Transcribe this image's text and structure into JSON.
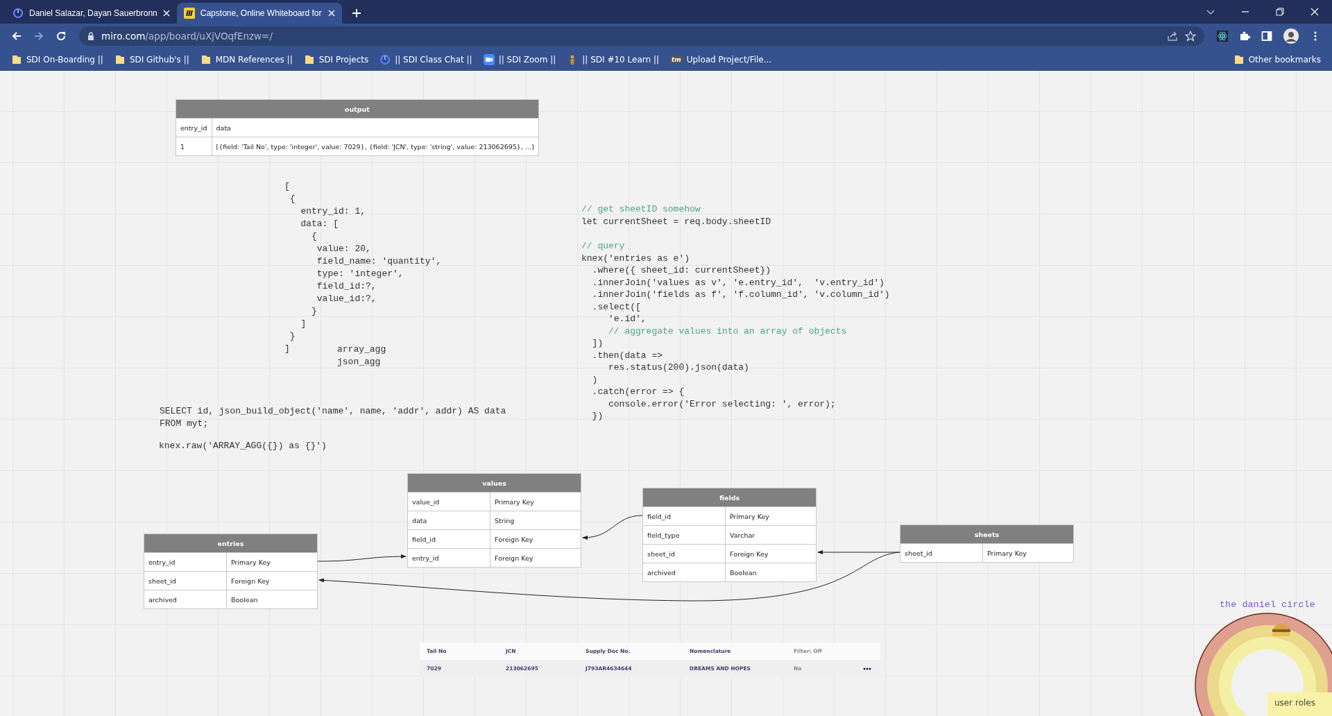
{
  "browser": {
    "tabs": [
      {
        "title": "Daniel Salazar, Dayan Sauerbronn",
        "kind": "ring",
        "selected": false
      },
      {
        "title": "Capstone, Online Whiteboard for",
        "kind": "miro",
        "selected": true
      }
    ],
    "url_host": "miro.com",
    "url_path": "/app/board/uXjVOqfEnzw=/",
    "bookmarks": [
      {
        "label": "SDI On-Boarding ||",
        "kind": "folder"
      },
      {
        "label": "SDI Github's ||",
        "kind": "folder"
      },
      {
        "label": "MDN References ||",
        "kind": "folder"
      },
      {
        "label": "SDI Projects",
        "kind": "folder"
      },
      {
        "label": "|| SDI Class Chat ||",
        "kind": "ring"
      },
      {
        "label": "|| SDI Zoom ||",
        "kind": "camera"
      },
      {
        "label": "|| SDI #10 Learn ||",
        "kind": "figure"
      },
      {
        "label": "Upload Project/File...",
        "kind": "badge",
        "badge_text": "tm"
      }
    ],
    "other_bookmarks": "Other bookmarks"
  },
  "board": {
    "output_table": {
      "title": "output",
      "rows": [
        [
          "entry_id",
          "data"
        ],
        [
          "1",
          "[{field: 'Tail No', type: 'integer', value: 7029}, {field: 'JCN', type: 'string', value: 213062695}, ...]"
        ]
      ]
    },
    "snippets": [
      {
        "lines": [
          {
            "text": "[",
            "kind": "code"
          },
          {
            "text": " {",
            "kind": "code"
          },
          {
            "text": "   entry_id: 1,",
            "kind": "code"
          },
          {
            "text": "   data: [",
            "kind": "code"
          },
          {
            "text": "     {",
            "kind": "code"
          },
          {
            "text": "      value: 20,",
            "kind": "code"
          },
          {
            "text": "      field_name: 'quantity',",
            "kind": "code"
          },
          {
            "text": "      type: 'integer',",
            "kind": "code"
          },
          {
            "text": "      field_id:?,",
            "kind": "code"
          },
          {
            "text": "      value_id:?,",
            "kind": "code"
          },
          {
            "text": "     }",
            "kind": "code"
          },
          {
            "text": "   ]",
            "kind": "code"
          },
          {
            "text": " }",
            "kind": "code"
          },
          {
            "text": "]",
            "kind": "code"
          }
        ]
      },
      {
        "lines": [
          {
            "text": "array_agg",
            "kind": "code"
          },
          {
            "text": "json_agg",
            "kind": "code"
          }
        ]
      },
      {
        "lines": [
          {
            "text": "// get sheetID somehow",
            "kind": "comment"
          },
          {
            "text": "let currentSheet = req.body.sheetID",
            "kind": "code"
          }
        ]
      },
      {
        "lines": [
          {
            "text": "// query",
            "kind": "comment"
          },
          {
            "text": "knex('entries as e')",
            "kind": "code"
          },
          {
            "text": "  .where({ sheet_id: currentSheet})",
            "kind": "code"
          },
          {
            "text": "  .innerJoin('values as v', 'e.entry_id',  'v.entry_id')",
            "kind": "code"
          },
          {
            "text": "  .innerJoin('fields as f', 'f.column_id', 'v.column_id')",
            "kind": "code"
          },
          {
            "text": "  .select([",
            "kind": "code"
          },
          {
            "text": "     'e.id',",
            "kind": "code"
          },
          {
            "text": "     // aggregate values into an array of objects",
            "kind": "comment"
          },
          {
            "text": "  ])",
            "kind": "code"
          },
          {
            "text": "  .then(data =>",
            "kind": "code"
          },
          {
            "text": "     res.status(200).json(data)",
            "kind": "code"
          },
          {
            "text": "  )",
            "kind": "code"
          },
          {
            "text": "  .catch(error => {",
            "kind": "code"
          },
          {
            "text": "     console.error('Error selecting: ', error);",
            "kind": "code"
          },
          {
            "text": "  })",
            "kind": "code"
          }
        ]
      },
      {
        "lines": [
          {
            "text": "SELECT id, json_build_object('name', name, 'addr', addr) AS data",
            "kind": "code"
          },
          {
            "text": "FROM myt;",
            "kind": "code"
          }
        ]
      },
      {
        "lines": [
          {
            "text": "knex.raw('ARRAY_AGG({}) as {}')",
            "kind": "code"
          }
        ]
      }
    ],
    "er_tables": [
      {
        "name": "values",
        "rows": [
          {
            "column": "value_id",
            "type": "Primary Key"
          },
          {
            "column": "data",
            "type": "String"
          },
          {
            "column": "field_id",
            "type": "Foreign Key"
          },
          {
            "column": "entry_id",
            "type": "Foreign Key"
          }
        ]
      },
      {
        "name": "fields",
        "rows": [
          {
            "column": "field_id",
            "type": "Primary Key"
          },
          {
            "column": "field_type",
            "type": "Varchar"
          },
          {
            "column": "sheet_id",
            "type": "Foreign Key"
          },
          {
            "column": "archived",
            "type": "Boolean"
          }
        ]
      },
      {
        "name": "entries",
        "rows": [
          {
            "column": "entry_id",
            "type": "Primary Key"
          },
          {
            "column": "sheet_id",
            "type": "Foreign Key"
          },
          {
            "column": "archived",
            "type": "Boolean"
          }
        ]
      },
      {
        "name": "sheets",
        "rows": [
          {
            "column": "sheet_id",
            "type": "Primary Key"
          }
        ]
      }
    ],
    "data_table": {
      "columns": [
        "Tail No",
        "JCN",
        "Supply Doc No.",
        "Nomenclature",
        "Filter: Off"
      ],
      "row": [
        "7029",
        "213062695",
        "J793AR4634644",
        "DREAMS AND HOPES",
        "No"
      ]
    },
    "circle_label": "the daniel circle",
    "sticky_note": "user roles"
  }
}
